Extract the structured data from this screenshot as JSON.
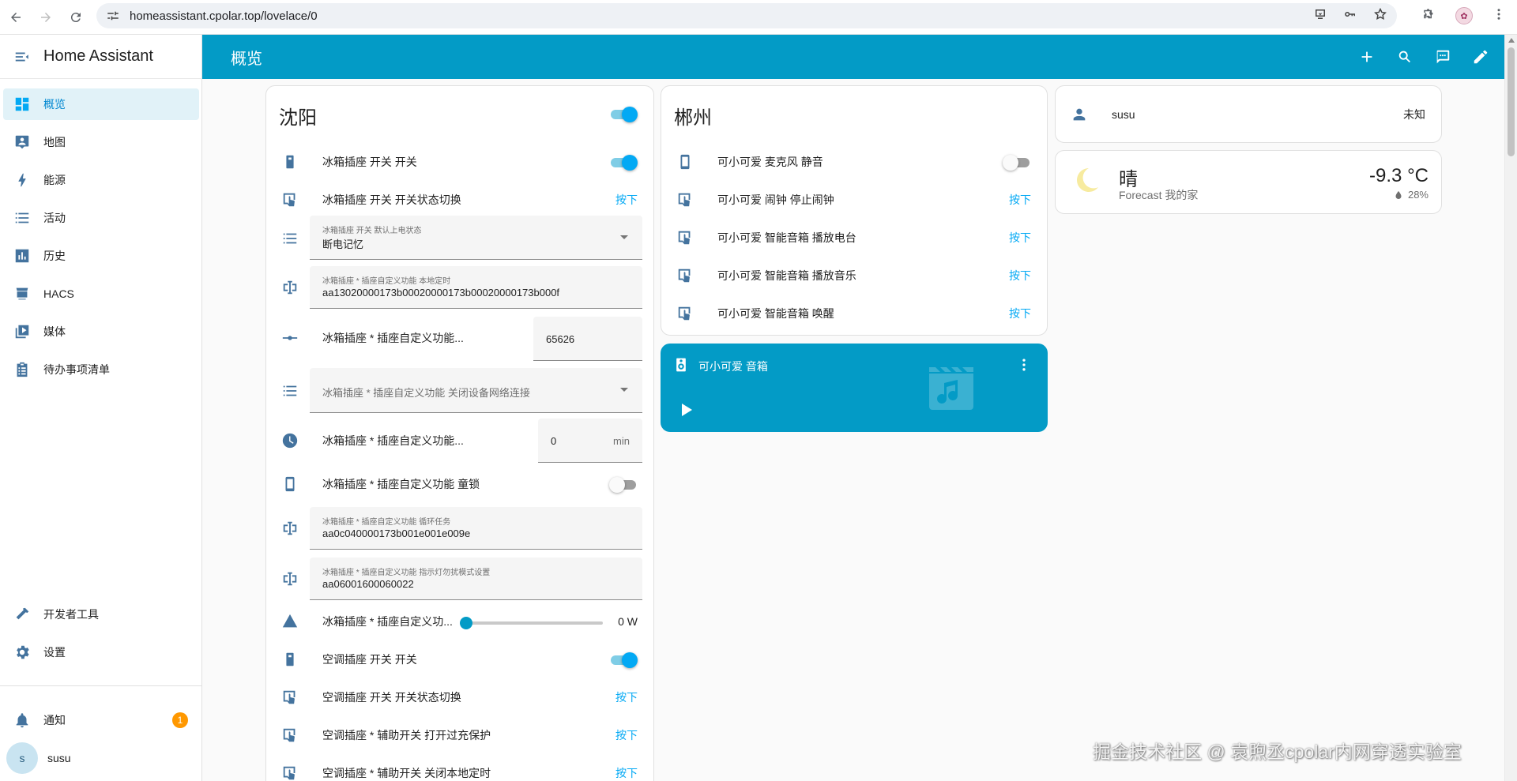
{
  "browser": {
    "url": "homeassistant.cpolar.top/lovelace/0"
  },
  "sidebar": {
    "title": "Home Assistant",
    "items": [
      {
        "label": "概览",
        "icon": "dashboard-icon",
        "selected": true
      },
      {
        "label": "地图",
        "icon": "map-icon"
      },
      {
        "label": "能源",
        "icon": "lightning-icon"
      },
      {
        "label": "活动",
        "icon": "list-icon"
      },
      {
        "label": "历史",
        "icon": "chart-icon"
      },
      {
        "label": "HACS",
        "icon": "hacs-icon"
      },
      {
        "label": "媒体",
        "icon": "media-icon"
      },
      {
        "label": "待办事项清单",
        "icon": "clipboard-icon"
      }
    ],
    "dev_tools": "开发者工具",
    "settings": "设置",
    "notifications": "通知",
    "notification_count": "1",
    "user_name": "susu",
    "user_initial": "s"
  },
  "header": {
    "title": "概览"
  },
  "shenyang": {
    "title": "沈阳",
    "title_toggle": true,
    "rows": {
      "r1": {
        "name": "冰箱插座 开关 开关",
        "toggle": true
      },
      "r2": {
        "name": "冰箱插座 开关 开关状态切换",
        "action": "按下"
      },
      "r3": {
        "label": "冰箱插座 开关 默认上电状态",
        "value": "断电记忆"
      },
      "r4": {
        "label": "冰箱插座 * 插座自定义功能 本地定时",
        "value": "aa13020000173b00020000173b00020000173b000f"
      },
      "r5": {
        "name": "冰箱插座 * 插座自定义功能...",
        "value": "65626"
      },
      "r6": {
        "placeholder": "冰箱插座 * 插座自定义功能 关闭设备网络连接"
      },
      "r7": {
        "name": "冰箱插座 * 插座自定义功能...",
        "value": "0",
        "unit": "min"
      },
      "r8": {
        "name": "冰箱插座 * 插座自定义功能 童锁",
        "toggle": false
      },
      "r9": {
        "label": "冰箱插座 * 插座自定义功能 循环任务",
        "value": "aa0c040000173b001e001e009e"
      },
      "r10": {
        "label": "冰箱插座 * 插座自定义功能 指示灯勿扰模式设置",
        "value": "aa06001600060022"
      },
      "r11": {
        "name": "冰箱插座 * 插座自定义功...",
        "value": "0 W",
        "level": 0
      },
      "r12": {
        "name": "空调插座 开关 开关",
        "toggle": true
      },
      "r13": {
        "name": "空调插座 开关 开关状态切换",
        "action": "按下"
      },
      "r14": {
        "name": "空调插座 * 辅助开关 打开过充保护",
        "action": "按下"
      },
      "r15": {
        "name": "空调插座 * 辅助开关 关闭本地定时",
        "action": "按下"
      }
    }
  },
  "chenzhou": {
    "title": "郴州",
    "rows": [
      {
        "name": "可小可爱 麦克风 静音",
        "toggle": false
      },
      {
        "name": "可小可爱 闹钟 停止闹钟",
        "action": "按下"
      },
      {
        "name": "可小可爱 智能音箱 播放电台",
        "action": "按下"
      },
      {
        "name": "可小可爱 智能音箱 播放音乐",
        "action": "按下"
      },
      {
        "name": "可小可爱 智能音箱 唤醒",
        "action": "按下"
      }
    ]
  },
  "media_player": {
    "name": "可小可爱 音箱"
  },
  "person": {
    "name": "susu",
    "state": "未知"
  },
  "weather": {
    "state": "晴",
    "subtitle": "Forecast 我的家",
    "temperature": "-9.3 °C",
    "humidity": "28%"
  },
  "watermark": "掘金技术社区 @ 袁煦丞cpolar内网穿透实验室",
  "colors": {
    "primary": "#039bc6",
    "accent": "#03a9f4",
    "icon": "#44739e",
    "badge": "#ff9800"
  }
}
